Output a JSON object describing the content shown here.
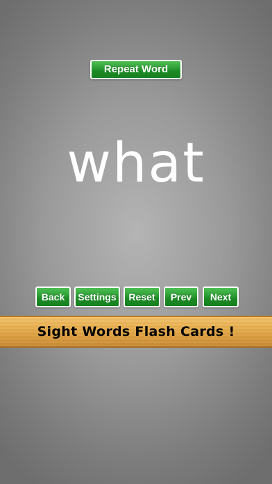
{
  "repeat_button": {
    "label": "Repeat Word"
  },
  "card": {
    "word": "what"
  },
  "nav": {
    "back_label": "Back",
    "settings_label": "Settings",
    "reset_label": "Reset",
    "prev_label": "Prev",
    "next_label": "Next"
  },
  "banner": {
    "title": "Sight Words Flash Cards !"
  },
  "colors": {
    "button_green": "#2fa036",
    "button_border": "#ffffff",
    "banner_wood": "#e7ae4e",
    "background_gray": "#9a9a9a",
    "word_text": "#ffffff"
  }
}
